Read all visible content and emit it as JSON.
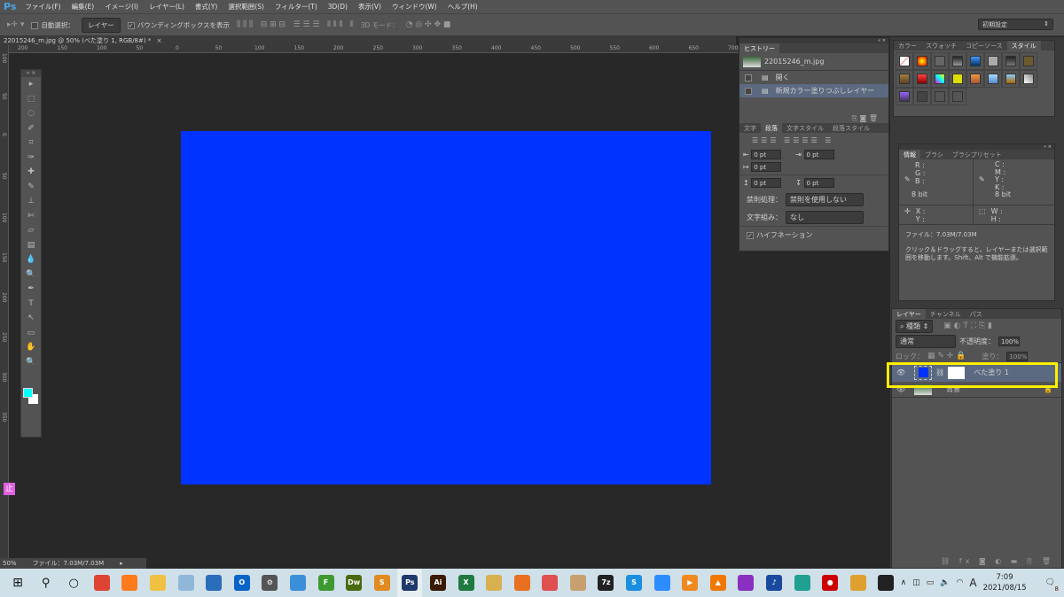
{
  "app": {
    "logo": "Ps"
  },
  "menu": [
    "ファイル(F)",
    "編集(E)",
    "イメージ(I)",
    "レイヤー(L)",
    "書式(Y)",
    "選択範囲(S)",
    "フィルター(T)",
    "3D(D)",
    "表示(V)",
    "ウィンドウ(W)",
    "ヘルプ(H)"
  ],
  "options": {
    "auto_select_label": "自動選択：",
    "auto_select_value": "レイヤー",
    "bounding_box_label": "バウンディングボックスを表示",
    "mode_3d_label": "3D モード：",
    "preset": "初期設定"
  },
  "document_tab": {
    "title": "22015246_m.jpg @ 50% (べた塗り 1, RGB/8#) *",
    "close": "×"
  },
  "ruler": {
    "horizontal": [
      "200",
      "150",
      "100",
      "50",
      "0",
      "50",
      "100",
      "150",
      "200",
      "250",
      "300",
      "350",
      "400",
      "450",
      "500",
      "550",
      "600",
      "650",
      "700"
    ],
    "vertical": [
      "100",
      "50",
      "0",
      "50",
      "100",
      "150",
      "200",
      "250",
      "300",
      "350"
    ]
  },
  "colors": {
    "canvas": "#0033ff",
    "foreground": "#00ffff",
    "background": "#ffffff",
    "highlight": "#ffee00"
  },
  "history": {
    "tab": "ヒストリー",
    "snapshot": "22015246_m.jpg",
    "items": [
      "開く",
      "新規カラー塗りつぶしレイヤー"
    ]
  },
  "paragraph": {
    "tabs": [
      "文字",
      "段落",
      "文字スタイル",
      "段落スタイル"
    ],
    "active": 1,
    "fields": [
      "0 pt",
      "0 pt",
      "0 pt",
      "0 pt",
      "0 pt"
    ],
    "kinsoku_label": "禁則処理：",
    "kinsoku_value": "禁則を使用しない",
    "mojikumi_label": "文字組み：",
    "mojikumi_value": "なし",
    "hyphenation": "ハイフネーション"
  },
  "styles": {
    "tabs": [
      "カラー",
      "スウォッチ",
      "コピーソース",
      "スタイル"
    ],
    "active": 3
  },
  "info": {
    "tabs": [
      "情報",
      "ブラシ",
      "ブラシプリセット"
    ],
    "active": 0,
    "rgb": [
      "R :",
      "G :",
      "B :"
    ],
    "cmyk": [
      "C :",
      "M :",
      "Y :",
      "K :"
    ],
    "bit_left": "8 bit",
    "bit_right": "8 bit",
    "xy": [
      "X :",
      "Y :"
    ],
    "wh": [
      "W :",
      "H :"
    ],
    "file": "ファイル：7.03M/7.03M",
    "hint": "クリック＆ドラッグすると、レイヤーまたは選択範囲を移動します。Shift、Alt で機能拡張。"
  },
  "layers": {
    "tabs": [
      "レイヤー",
      "チャンネル",
      "パス"
    ],
    "active": 0,
    "filter": "種類",
    "blend": "通常",
    "opacity_label": "不透明度：",
    "opacity": "100%",
    "lock_label": "ロック：",
    "fill_label": "塗り：",
    "fill": "100%",
    "items": [
      {
        "name": "べた塗り 1",
        "selected": true
      },
      {
        "name": "背景",
        "locked": true
      }
    ]
  },
  "status": {
    "zoom": "50%",
    "file": "ファイル：7.03M/7.03M"
  },
  "taskbar": {
    "apps": [
      {
        "name": "chrome",
        "label": "",
        "color": "#dd4433"
      },
      {
        "name": "firefox",
        "label": "",
        "color": "#ff7a1a"
      },
      {
        "name": "explorer",
        "label": "",
        "color": "#f0c040"
      },
      {
        "name": "notepad",
        "label": "",
        "color": "#8fb8d8"
      },
      {
        "name": "photos",
        "label": "",
        "color": "#2a6ebb"
      },
      {
        "name": "outlook",
        "label": "O",
        "color": "#0a64c8"
      },
      {
        "name": "settings",
        "label": "⚙",
        "color": "#555555"
      },
      {
        "name": "contacts",
        "label": "",
        "color": "#3a8fd8"
      },
      {
        "name": "ftp",
        "label": "F",
        "color": "#3c9a30"
      },
      {
        "name": "dreamweaver",
        "label": "Dw",
        "color": "#4a6a10"
      },
      {
        "name": "sublime",
        "label": "S",
        "color": "#e08a20"
      },
      {
        "name": "photoshop",
        "label": "Ps",
        "color": "#1f3a6a"
      },
      {
        "name": "illustrator",
        "label": "Ai",
        "color": "#3a1a00"
      },
      {
        "name": "excel",
        "label": "X",
        "color": "#1f7a40"
      },
      {
        "name": "pen-app",
        "label": "",
        "color": "#d8b050"
      },
      {
        "name": "butterfly",
        "label": "",
        "color": "#e87020"
      },
      {
        "name": "snip",
        "label": "",
        "color": "#e05050"
      },
      {
        "name": "paint",
        "label": "",
        "color": "#c8a070"
      },
      {
        "name": "7zip",
        "label": "7z",
        "color": "#222222"
      },
      {
        "name": "skype",
        "label": "S",
        "color": "#1a8fe0"
      },
      {
        "name": "zoom",
        "label": "",
        "color": "#2d8cff"
      },
      {
        "name": "player",
        "label": "▶",
        "color": "#f08a20"
      },
      {
        "name": "vlc",
        "label": "▲",
        "color": "#f07800"
      },
      {
        "name": "purple-app",
        "label": "",
        "color": "#8a30c0"
      },
      {
        "name": "music",
        "label": "♪",
        "color": "#1a4aa0"
      },
      {
        "name": "brain-app",
        "label": "",
        "color": "#20a090"
      },
      {
        "name": "recorder",
        "label": "●",
        "color": "#cc0000"
      },
      {
        "name": "bear-app",
        "label": "",
        "color": "#e0a030"
      },
      {
        "name": "sticky",
        "label": "",
        "color": "#222222"
      }
    ],
    "time": "7:09",
    "date": "2021/08/15",
    "notifications": "8",
    "ime": "A"
  }
}
